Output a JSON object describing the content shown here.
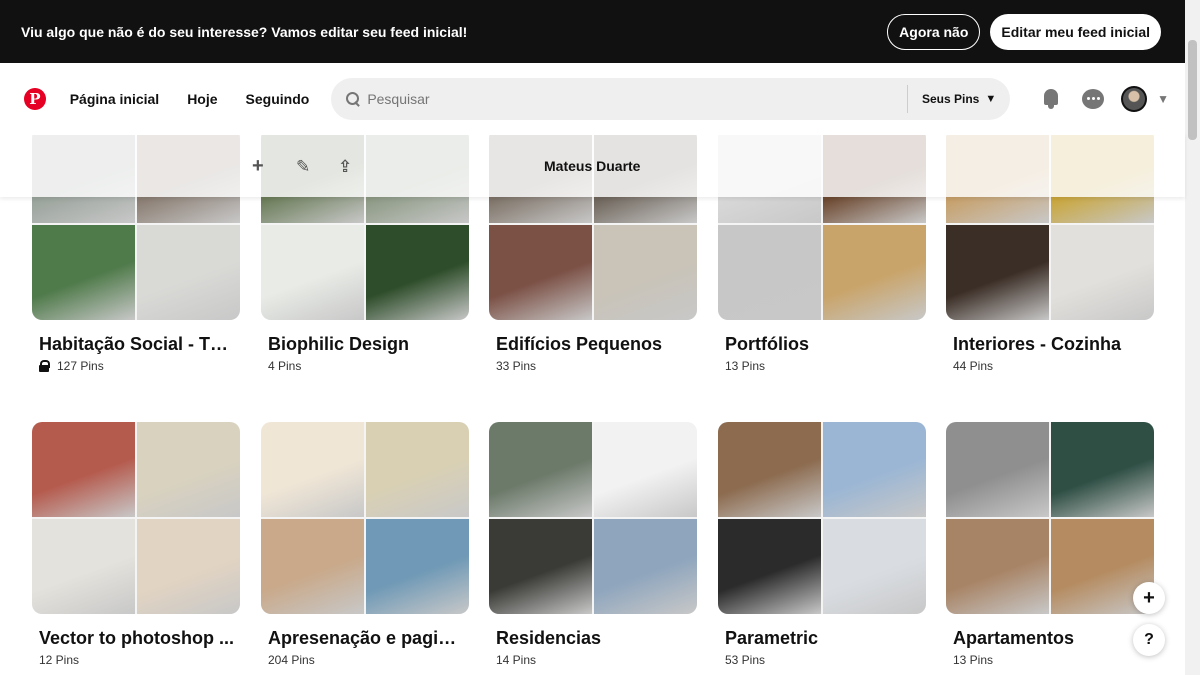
{
  "banner": {
    "text": "Viu algo que não é do seu interesse? Vamos editar seu feed inicial!",
    "dismiss_label": "Agora não",
    "edit_label": "Editar meu feed inicial"
  },
  "header": {
    "logo_letter": "P",
    "nav": [
      "Página inicial",
      "Hoje",
      "Seguindo"
    ],
    "search_placeholder": "Pesquisar",
    "search_scope": "Seus Pins"
  },
  "profile_bar": {
    "name": "Mateus Duarte",
    "icons": [
      "plus-icon",
      "pencil-icon",
      "share-icon"
    ]
  },
  "boards": [
    {
      "title": "Habitação Social - TCC",
      "pins": "127 Pins",
      "secret": true,
      "colors": [
        "#9aa39c",
        "#8a7d72",
        "#4f7a4a",
        "#d9d9d6"
      ]
    },
    {
      "title": "Biophilic Design",
      "pins": "4 Pins",
      "secret": false,
      "colors": [
        "#6b7d5a",
        "#8d9a85",
        "#e8ebe6",
        "#2e4d2a"
      ]
    },
    {
      "title": "Edifícios Pequenos",
      "pins": "33 Pins",
      "secret": false,
      "colors": [
        "#7f7469",
        "#6f665c",
        "#7b5045",
        "#c9c3b8"
      ]
    },
    {
      "title": "Portfólios",
      "pins": "13 Pins",
      "secret": false,
      "colors": [
        "#d8d8d8",
        "#6e4a32",
        "#c7c7c7",
        "#c9a46a"
      ]
    },
    {
      "title": "Interiores - Cozinha",
      "pins": "44 Pins",
      "secret": false,
      "colors": [
        "#c7a06a",
        "#c9a63c",
        "#3b2e26",
        "#e2e0dc"
      ]
    },
    {
      "title": "Vector to photoshop ...",
      "pins": "12 Pins",
      "secret": false,
      "colors": [
        "#b55b4e",
        "#d9d2bf",
        "#e4e2dc",
        "#e2d4c2"
      ]
    },
    {
      "title": "Apresenação e pagin...",
      "pins": "204 Pins",
      "secret": false,
      "colors": [
        "#f0e6d6",
        "#d9d0b4",
        "#c9a98a",
        "#6f99b6"
      ]
    },
    {
      "title": "Residencias",
      "pins": "14 Pins",
      "secret": false,
      "colors": [
        "#6c7a6a",
        "#f2f2f2",
        "#3a3a36",
        "#8ea5bd"
      ]
    },
    {
      "title": "Parametric",
      "pins": "53 Pins",
      "secret": false,
      "colors": [
        "#8c6b4f",
        "#9bb6d4",
        "#2b2b2b",
        "#d9dde2"
      ]
    },
    {
      "title": "Apartamentos",
      "pins": "13 Pins",
      "secret": false,
      "colors": [
        "#8f8f8f",
        "#2f4f45",
        "#a88466",
        "#b58c62"
      ]
    }
  ],
  "floating": {
    "add_label": "+",
    "help_label": "?"
  }
}
